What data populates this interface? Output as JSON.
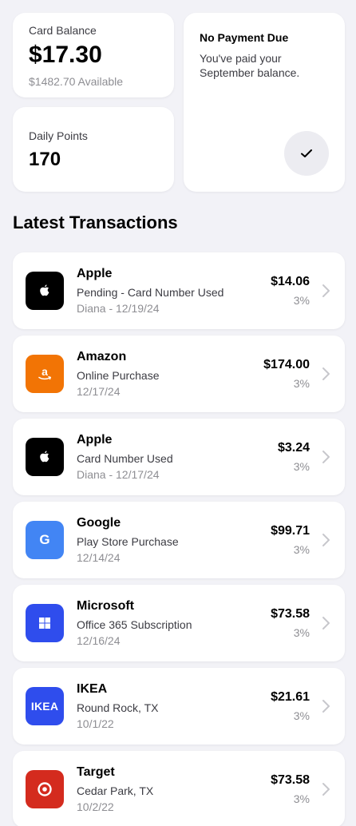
{
  "balance": {
    "label": "Card Balance",
    "value": "$17.30",
    "available": "$1482.70 Available"
  },
  "points": {
    "label": "Daily Points",
    "value": "170"
  },
  "payment": {
    "title": "No Payment Due",
    "description": "You've paid your September balance.",
    "icon": "checkmark-icon"
  },
  "section_title": "Latest Transactions",
  "colors": {
    "apple": "#000000",
    "amazon": "#f27405",
    "google": "#4285f4",
    "microsoft": "#2f4ded",
    "ikea": "#2f4ded",
    "target": "#d42b1e"
  },
  "transactions": [
    {
      "merchant": "Apple",
      "description": "Pending - Card Number Used",
      "meta": "Diana - 12/19/24",
      "amount": "$14.06",
      "percent": "3%",
      "icon": "apple-logo-icon"
    },
    {
      "merchant": "Amazon",
      "description": "Online Purchase",
      "meta": "12/17/24",
      "amount": "$174.00",
      "percent": "3%",
      "icon": "amazon-logo-icon"
    },
    {
      "merchant": "Apple",
      "description": "Card Number Used",
      "meta": "Diana - 12/17/24",
      "amount": "$3.24",
      "percent": "3%",
      "icon": "apple-logo-icon"
    },
    {
      "merchant": "Google",
      "description": "Play Store Purchase",
      "meta": "12/14/24",
      "amount": "$99.71",
      "percent": "3%",
      "icon": "google-logo-icon",
      "logo_text": "G"
    },
    {
      "merchant": "Microsoft",
      "description": "Office 365 Subscription",
      "meta": "12/16/24",
      "amount": "$73.58",
      "percent": "3%",
      "icon": "windows-logo-icon"
    },
    {
      "merchant": "IKEA",
      "description": "Round Rock, TX",
      "meta": "10/1/22",
      "amount": "$21.61",
      "percent": "3%",
      "icon": "ikea-logo-icon",
      "logo_text": "IKEA"
    },
    {
      "merchant": "Target",
      "description": "Cedar Park, TX",
      "meta": "10/2/22",
      "amount": "$73.58",
      "percent": "3%",
      "icon": "target-logo-icon"
    }
  ]
}
